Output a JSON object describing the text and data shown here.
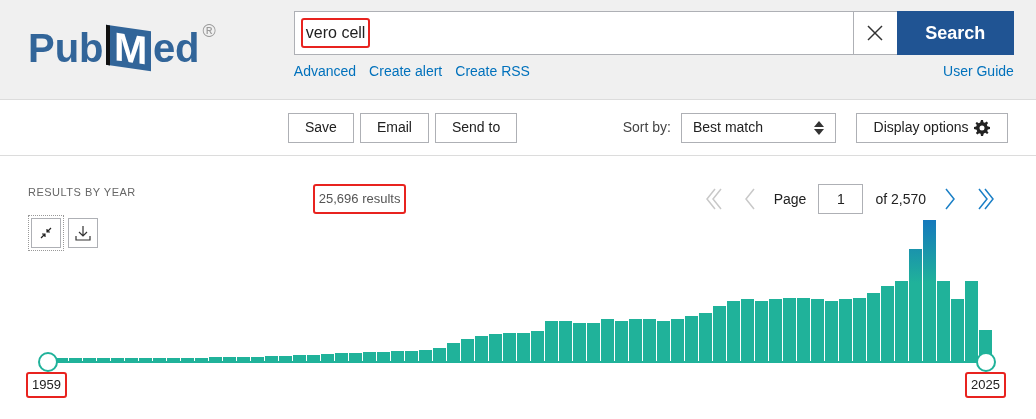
{
  "logo": {
    "parts": [
      "Pub",
      "M",
      "ed"
    ],
    "mark": "®"
  },
  "search": {
    "value": "vero cell",
    "highlighted": true,
    "button": "Search"
  },
  "search_links": [
    "Advanced",
    "Create alert",
    "Create RSS"
  ],
  "user_guide": "User Guide",
  "actions": [
    "Save",
    "Email",
    "Send to"
  ],
  "sort": {
    "label": "Sort by:",
    "value": "Best match"
  },
  "display_options": "Display options",
  "results_by_year": {
    "title": "RESULTS BY YEAR",
    "start_year": "1959",
    "end_year": "2025",
    "start_highlighted": true,
    "end_highlighted": true
  },
  "results": {
    "text": "25,696 results",
    "highlighted": true
  },
  "pagination": {
    "first_disabled": true,
    "prev_disabled": true,
    "label": "Page",
    "page": "1",
    "of": "of 2,570",
    "next_disabled": false,
    "last_disabled": false
  }
}
